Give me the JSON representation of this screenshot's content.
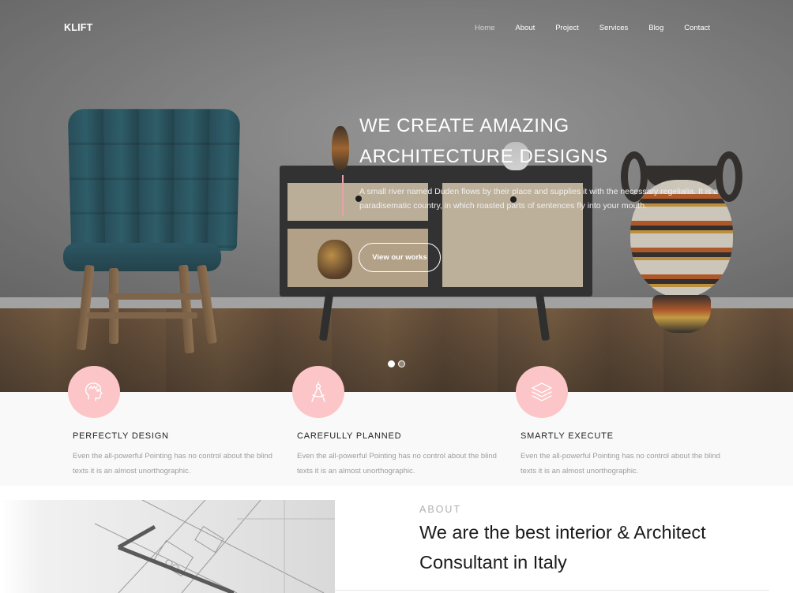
{
  "nav": {
    "brand": "KLIFT",
    "links": [
      {
        "label": "Home",
        "active": true
      },
      {
        "label": "About",
        "active": false
      },
      {
        "label": "Project",
        "active": false
      },
      {
        "label": "Services",
        "active": false
      },
      {
        "label": "Blog",
        "active": false
      },
      {
        "label": "Contact",
        "active": false
      }
    ]
  },
  "hero": {
    "title_line1": "WE CREATE AMAZING",
    "title_line2": "ARCHITECTURE DESIGNS",
    "text": "A small river named Duden flows by their place and supplies it with the necessary regelialia. It is a paradisematic country, in which roasted parts of sentences fly into your mouth.",
    "button_label": "View our works",
    "slides_total": 2,
    "active_slide": 1
  },
  "features": [
    {
      "icon": "idea-head-icon",
      "title": "PERFECTLY DESIGN",
      "text": "Even the all-powerful Pointing has no control about the blind texts it is an almost unorthographic."
    },
    {
      "icon": "compass-icon",
      "title": "CAREFULLY PLANNED",
      "text": "Even the all-powerful Pointing has no control about the blind texts it is an almost unorthographic."
    },
    {
      "icon": "layers-icon",
      "title": "SMARTLY EXECUTE",
      "text": "Even the all-powerful Pointing has no control about the blind texts it is an almost unorthographic."
    }
  ],
  "about": {
    "label": "ABOUT",
    "title": "We are the best interior & Architect Consultant in Italy"
  },
  "colors": {
    "accent": "#fcc5c8",
    "accent_line": "#e8a1a5",
    "text_dark": "#1a1a1a",
    "text_muted": "#9c9c9c"
  }
}
